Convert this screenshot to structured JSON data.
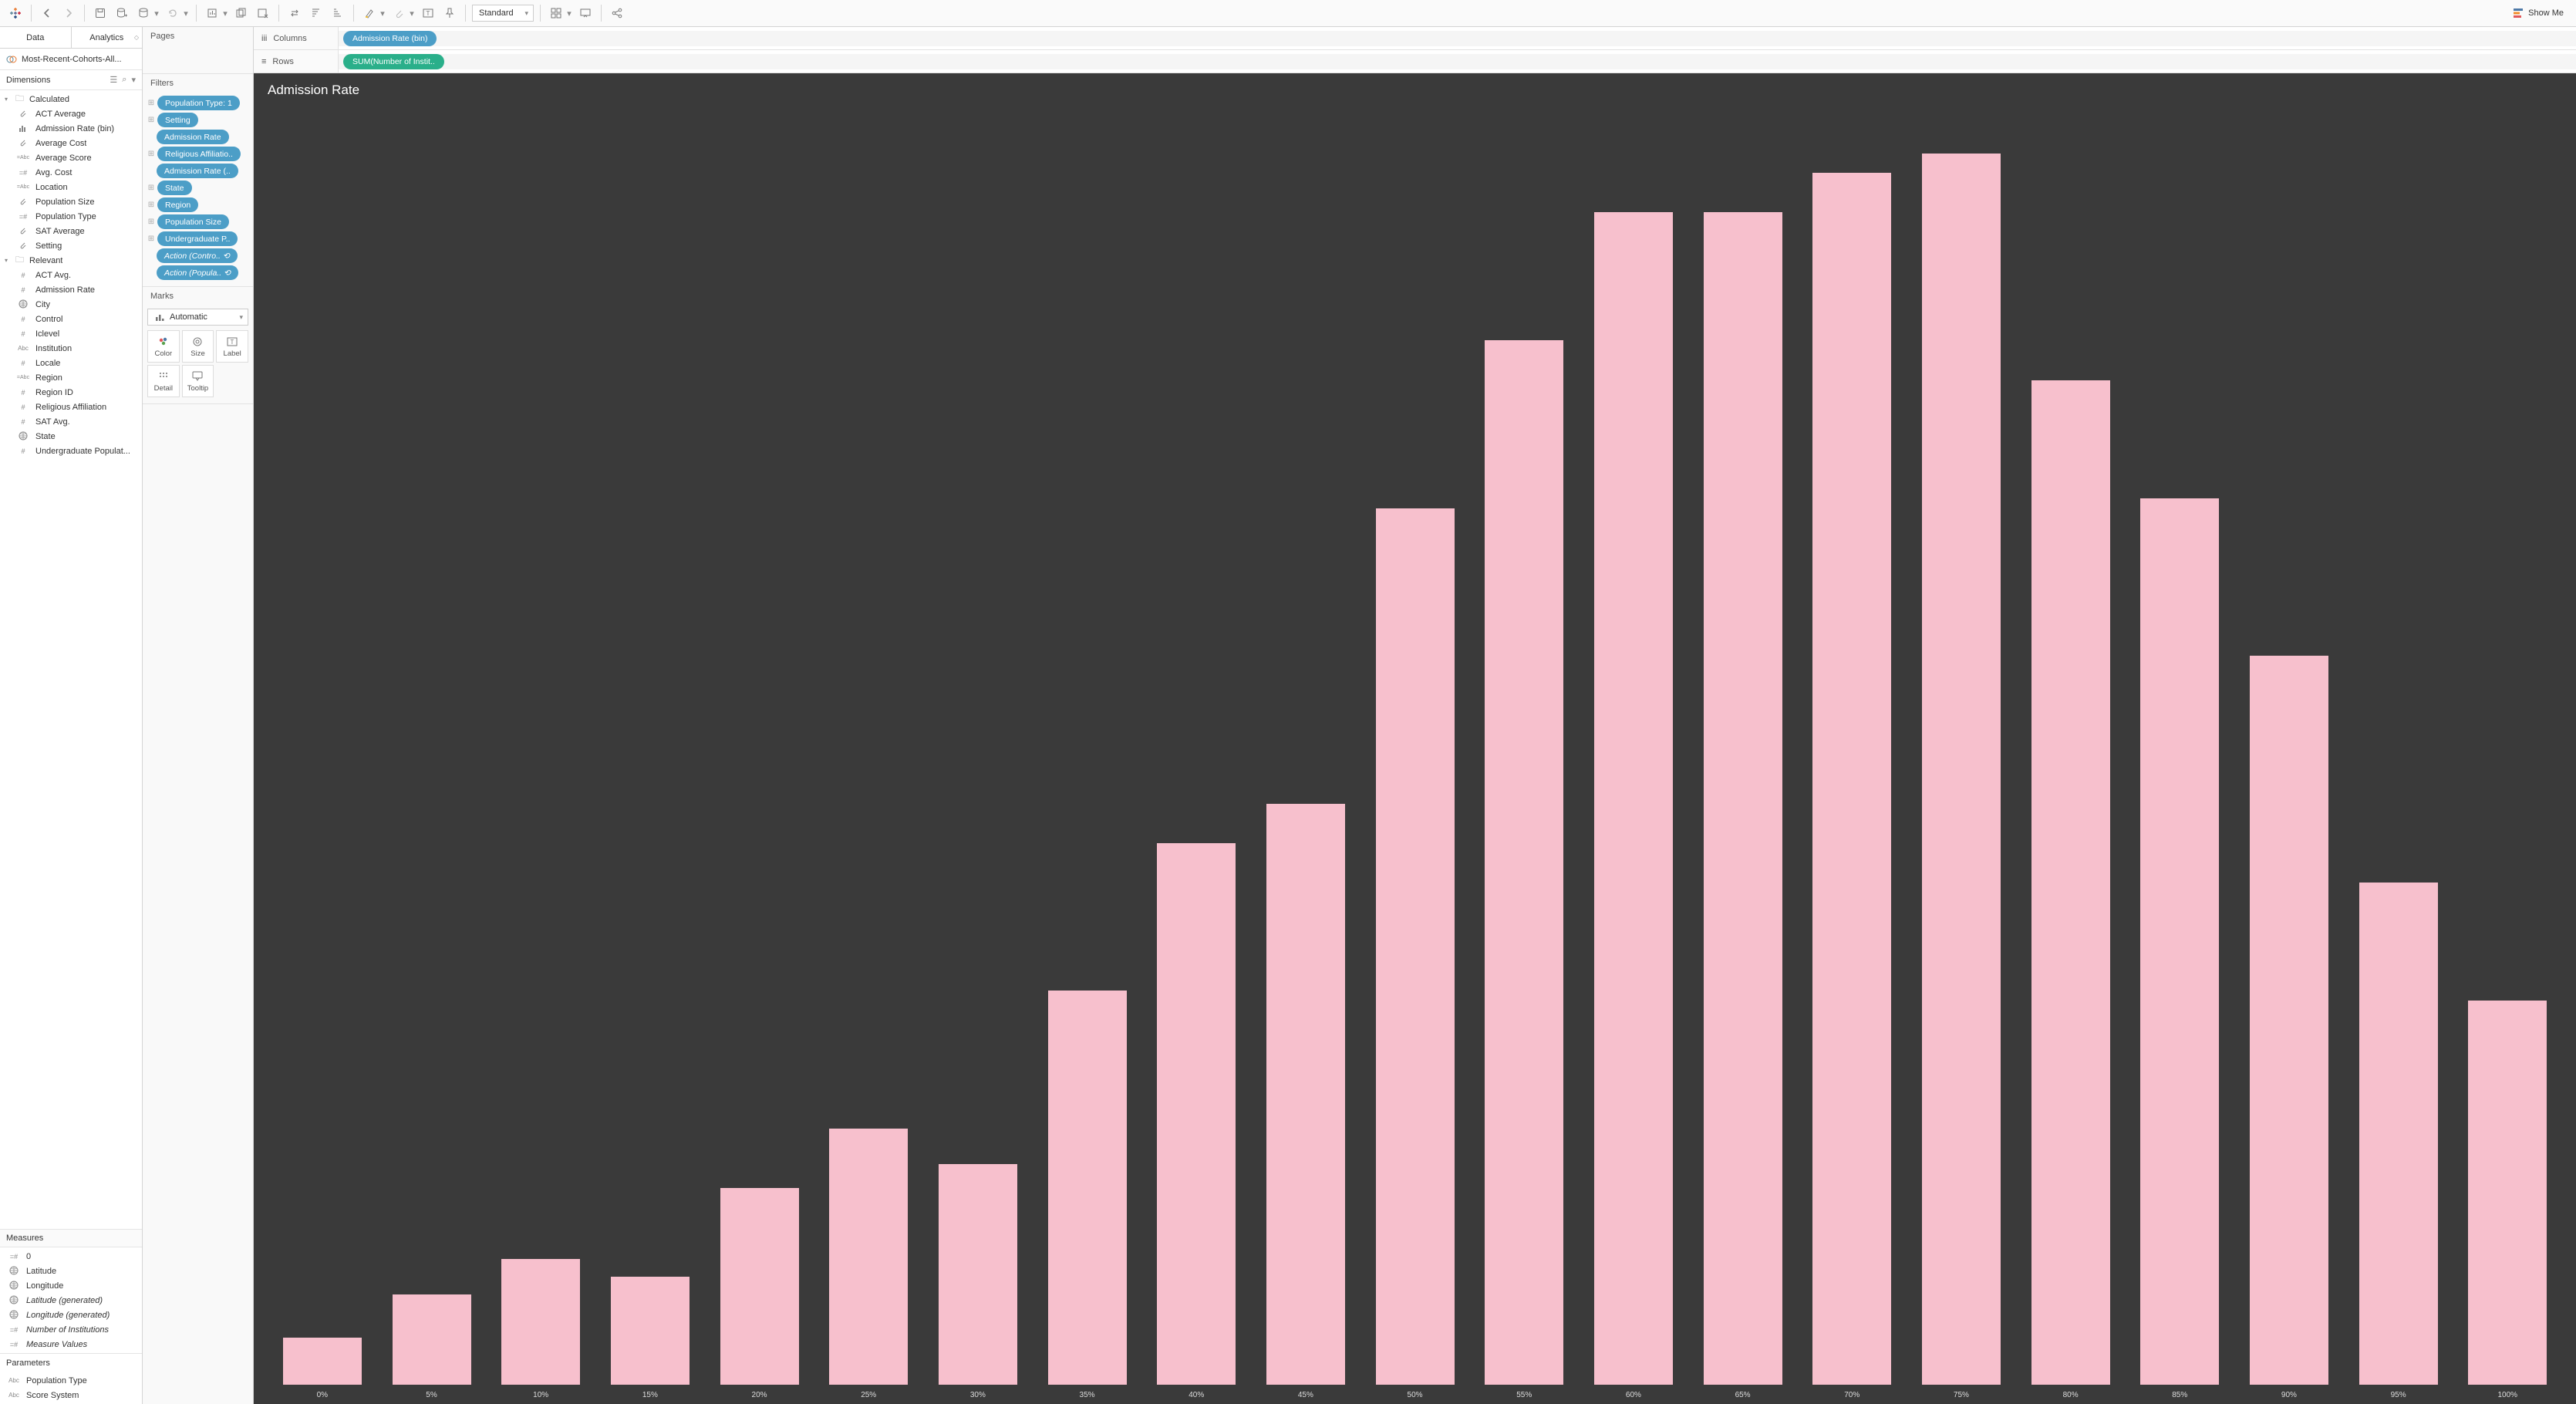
{
  "toolbar": {
    "fit_mode": "Standard",
    "show_me_label": "Show Me"
  },
  "data_pane": {
    "tabs": {
      "data": "Data",
      "analytics": "Analytics"
    },
    "datasource": "Most-Recent-Cohorts-All...",
    "dimensions_label": "Dimensions",
    "folders": [
      {
        "name": "Calculated",
        "fields": [
          {
            "icon": "clip",
            "label": "ACT Average"
          },
          {
            "icon": "bin",
            "label": "Admission Rate (bin)"
          },
          {
            "icon": "clip",
            "label": "Average Cost"
          },
          {
            "icon": "=Abc",
            "label": "Average Score"
          },
          {
            "icon": "=#",
            "label": "Avg. Cost"
          },
          {
            "icon": "=Abc",
            "label": "Location"
          },
          {
            "icon": "clip",
            "label": "Population Size"
          },
          {
            "icon": "=#",
            "label": "Population Type"
          },
          {
            "icon": "clip",
            "label": "SAT Average"
          },
          {
            "icon": "clip",
            "label": "Setting"
          }
        ]
      },
      {
        "name": "Relevant",
        "fields": [
          {
            "icon": "#",
            "label": "ACT Avg."
          },
          {
            "icon": "#",
            "label": "Admission Rate"
          },
          {
            "icon": "globe",
            "label": "City"
          },
          {
            "icon": "#",
            "label": "Control"
          },
          {
            "icon": "#",
            "label": "Iclevel"
          },
          {
            "icon": "Abc",
            "label": "Institution"
          },
          {
            "icon": "#",
            "label": "Locale"
          },
          {
            "icon": "=Abc",
            "label": "Region"
          },
          {
            "icon": "#",
            "label": "Region ID"
          },
          {
            "icon": "#",
            "label": "Religious Affiliation"
          },
          {
            "icon": "#",
            "label": "SAT Avg."
          },
          {
            "icon": "globe",
            "label": "State"
          },
          {
            "icon": "#",
            "label": "Undergraduate Populat..."
          }
        ]
      }
    ],
    "measures_label": "Measures",
    "measures": [
      {
        "icon": "=#",
        "label": "0",
        "italic": false
      },
      {
        "icon": "globe",
        "label": "Latitude",
        "italic": false
      },
      {
        "icon": "globe",
        "label": "Longitude",
        "italic": false
      },
      {
        "icon": "globe",
        "label": "Latitude (generated)",
        "italic": true
      },
      {
        "icon": "globe",
        "label": "Longitude (generated)",
        "italic": true
      },
      {
        "icon": "=#",
        "label": "Number of Institutions",
        "italic": true
      },
      {
        "icon": "=#",
        "label": "Measure Values",
        "italic": true
      }
    ],
    "parameters_label": "Parameters",
    "parameters": [
      {
        "icon": "Abc",
        "label": "Population Type"
      },
      {
        "icon": "Abc",
        "label": "Score System"
      }
    ]
  },
  "mid": {
    "pages_label": "Pages",
    "filters_label": "Filters",
    "filters": [
      {
        "label": "Population Type: 1",
        "indent": false,
        "ctx": true
      },
      {
        "label": "Setting",
        "indent": false,
        "ctx": true
      },
      {
        "label": "Admission Rate",
        "indent": true,
        "ctx": false
      },
      {
        "label": "Religious Affiliatio..",
        "indent": false,
        "ctx": true
      },
      {
        "label": "Admission Rate (..",
        "indent": true,
        "ctx": false
      },
      {
        "label": "State",
        "indent": false,
        "ctx": true
      },
      {
        "label": "Region",
        "indent": false,
        "ctx": true
      },
      {
        "label": "Population Size",
        "indent": false,
        "ctx": true
      },
      {
        "label": "Undergraduate P..",
        "indent": false,
        "ctx": true
      },
      {
        "label": "Action (Contro.. ⟲",
        "indent": true,
        "ctx": false,
        "action": true
      },
      {
        "label": "Action (Popula.. ⟲",
        "indent": true,
        "ctx": false,
        "action": true
      }
    ],
    "marks_label": "Marks",
    "mark_type": "Automatic",
    "mark_cells": [
      {
        "label": "Color"
      },
      {
        "label": "Size"
      },
      {
        "label": "Label"
      },
      {
        "label": "Detail"
      },
      {
        "label": "Tooltip"
      }
    ]
  },
  "shelves": {
    "columns_label": "Columns",
    "rows_label": "Rows",
    "columns_pill": "Admission Rate (bin)",
    "rows_pill": "SUM(Number of Instit.."
  },
  "viz": {
    "title": "Admission Rate"
  },
  "chart_data": {
    "type": "bar",
    "title": "Admission Rate",
    "xlabel": "Admission Rate (bin)",
    "ylabel": "Number of Institutions",
    "categories": [
      "0%",
      "5%",
      "10%",
      "15%",
      "20%",
      "25%",
      "30%",
      "35%",
      "40%",
      "45%",
      "50%",
      "55%",
      "60%",
      "65%",
      "70%",
      "75%",
      "80%",
      "85%",
      "90%",
      "95%",
      "100%"
    ],
    "values": [
      24,
      46,
      64,
      55,
      100,
      130,
      112,
      200,
      275,
      295,
      445,
      530,
      595,
      595,
      615,
      625,
      510,
      450,
      370,
      255,
      195
    ],
    "ylim": [
      0,
      650
    ],
    "bar_color": "#f7c0cd",
    "plot_bg": "#3a3a3a"
  }
}
